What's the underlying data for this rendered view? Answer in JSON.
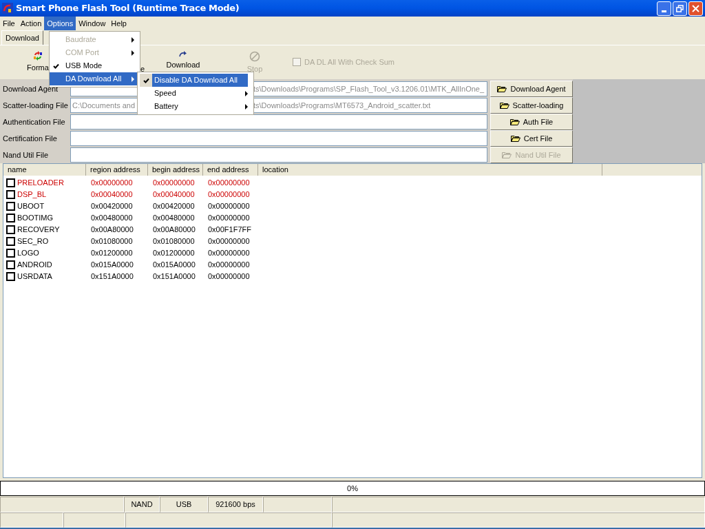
{
  "window": {
    "title": "Smart Phone Flash Tool (Runtime Trace Mode)"
  },
  "menu_bar": [
    {
      "label": "File",
      "selected": false
    },
    {
      "label": "Action",
      "selected": false
    },
    {
      "label": "Options",
      "selected": true
    },
    {
      "label": "Window",
      "selected": false
    },
    {
      "label": "Help",
      "selected": false
    }
  ],
  "tabs": [
    {
      "label": "Download",
      "selected": true
    }
  ],
  "toolbar": [
    {
      "kind": "format",
      "label": "Forma",
      "disabled": false
    },
    {
      "kind": "hidden",
      "label": "e",
      "disabled": false
    },
    {
      "kind": "download",
      "label": "Download",
      "disabled": false
    },
    {
      "kind": "stop",
      "label": "Stop",
      "disabled": true
    }
  ],
  "checksum": {
    "label": "DA DL All With Check Sum",
    "checked": false,
    "disabled": true
  },
  "files": [
    {
      "label": "Download Agent",
      "value_end": "ts\\Downloads\\Programs\\SP_Flash_Tool_v3.1206.01\\MTK_AllInOne_",
      "button": "Download Agent",
      "disabled": false
    },
    {
      "label": "Scatter-loading File",
      "value_start": "C:\\Documents and",
      "value_end": "ts\\Downloads\\Programs\\MT6573_Android_scatter.txt",
      "button": "Scatter-loading",
      "disabled": false
    },
    {
      "label": "Authentication File",
      "button": "Auth File",
      "disabled": false
    },
    {
      "label": "Certification File",
      "button": "Cert File",
      "disabled": false
    },
    {
      "label": "Nand Util File",
      "button": "Nand Util File",
      "disabled": true
    }
  ],
  "table": {
    "columns": [
      "name",
      "region address",
      "begin address",
      "end address",
      "location"
    ],
    "rows": [
      {
        "checked": false,
        "color": "#cc0000",
        "cells": [
          "PRELOADER",
          "0x00000000",
          "0x00000000",
          "0x00000000"
        ]
      },
      {
        "checked": false,
        "color": "#cc0000",
        "cells": [
          "DSP_BL",
          "0x00040000",
          "0x00040000",
          "0x00000000"
        ]
      },
      {
        "checked": false,
        "color": "#000000",
        "cells": [
          "UBOOT",
          "0x00420000",
          "0x00420000",
          "0x00000000"
        ]
      },
      {
        "checked": false,
        "color": "#000000",
        "cells": [
          "BOOTIMG",
          "0x00480000",
          "0x00480000",
          "0x00000000"
        ]
      },
      {
        "checked": false,
        "color": "#000000",
        "cells": [
          "RECOVERY",
          "0x00A80000",
          "0x00A80000",
          "0x00F1F7FF"
        ]
      },
      {
        "checked": false,
        "color": "#000000",
        "cells": [
          "SEC_RO",
          "0x01080000",
          "0x01080000",
          "0x00000000"
        ]
      },
      {
        "checked": false,
        "color": "#000000",
        "cells": [
          "LOGO",
          "0x01200000",
          "0x01200000",
          "0x00000000"
        ]
      },
      {
        "checked": false,
        "color": "#000000",
        "cells": [
          "ANDROID",
          "0x015A0000",
          "0x015A0000",
          "0x00000000"
        ]
      },
      {
        "checked": false,
        "color": "#000000",
        "cells": [
          "USRDATA",
          "0x151A0000",
          "0x151A0000",
          "0x00000000"
        ]
      }
    ]
  },
  "progress": {
    "label": "0%",
    "level": 0
  },
  "status_bar": {
    "row_1": [
      "NAND",
      "USB",
      "921600 bps"
    ]
  },
  "options_menu": [
    {
      "label": "Baudrate",
      "disabled": true,
      "checked": false,
      "submenu": true,
      "selected": false
    },
    {
      "label": "COM Port",
      "disabled": true,
      "checked": false,
      "submenu": true,
      "selected": false
    },
    {
      "label": "USB Mode",
      "disabled": false,
      "checked": true,
      "submenu": false,
      "selected": false
    },
    {
      "label": "DA Download All",
      "disabled": false,
      "checked": false,
      "submenu": true,
      "selected": true
    }
  ],
  "submenu": [
    {
      "label": "Disable DA Download All",
      "checked": true,
      "submenu": false,
      "selected": true
    },
    {
      "label": "Speed",
      "checked": false,
      "submenu": true,
      "selected": false
    },
    {
      "label": "Battery",
      "checked": false,
      "submenu": true,
      "selected": false
    }
  ]
}
